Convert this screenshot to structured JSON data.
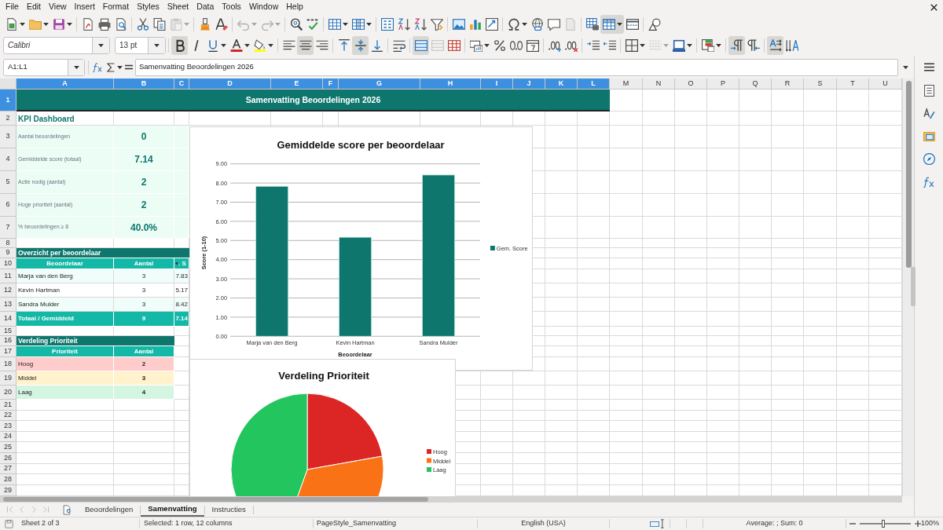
{
  "menu_bar": {
    "items": [
      "File",
      "Edit",
      "View",
      "Insert",
      "Format",
      "Styles",
      "Sheet",
      "Data",
      "Tools",
      "Window",
      "Help"
    ]
  },
  "standard_toolbar": {
    "groups": [
      {
        "buttons": [
          {
            "kind": "new",
            "dropdown": true,
            "pressed": false,
            "disabled": false
          },
          {
            "kind": "open",
            "dropdown": true,
            "pressed": false,
            "disabled": false
          },
          {
            "kind": "save",
            "dropdown": true,
            "pressed": false,
            "disabled": false
          }
        ]
      },
      {
        "buttons": [
          {
            "kind": "pdf",
            "dropdown": false,
            "pressed": false,
            "disabled": false
          },
          {
            "kind": "print",
            "dropdown": false,
            "pressed": false,
            "disabled": false
          },
          {
            "kind": "preview",
            "dropdown": false,
            "pressed": false,
            "disabled": false
          }
        ]
      },
      {
        "buttons": [
          {
            "kind": "cut",
            "dropdown": false,
            "pressed": false,
            "disabled": false
          },
          {
            "kind": "copy",
            "dropdown": false,
            "pressed": false,
            "disabled": false
          },
          {
            "kind": "paste",
            "dropdown": true,
            "pressed": false,
            "disabled": true
          }
        ]
      },
      {
        "buttons": [
          {
            "kind": "clone",
            "dropdown": false,
            "pressed": false,
            "disabled": false
          },
          {
            "kind": "clear",
            "dropdown": false,
            "pressed": false,
            "disabled": false
          }
        ]
      },
      {
        "buttons": [
          {
            "kind": "undo",
            "dropdown": true,
            "pressed": false,
            "disabled": true
          },
          {
            "kind": "redo",
            "dropdown": true,
            "pressed": false,
            "disabled": true
          }
        ]
      },
      {
        "buttons": [
          {
            "kind": "find",
            "dropdown": false,
            "pressed": false,
            "disabled": false
          },
          {
            "kind": "spelling",
            "dropdown": false,
            "pressed": false,
            "disabled": false
          }
        ]
      },
      {
        "buttons": [
          {
            "kind": "rows",
            "dropdown": true,
            "pressed": false,
            "disabled": false
          },
          {
            "kind": "columns",
            "dropdown": true,
            "pressed": false,
            "disabled": false
          }
        ]
      },
      {
        "buttons": [
          {
            "kind": "sort",
            "dropdown": false,
            "pressed": false,
            "disabled": false
          },
          {
            "kind": "ascending",
            "dropdown": false,
            "pressed": false,
            "disabled": false
          },
          {
            "kind": "descending",
            "dropdown": false,
            "pressed": false,
            "disabled": false
          },
          {
            "kind": "filter",
            "dropdown": false,
            "pressed": false,
            "disabled": false
          }
        ]
      },
      {
        "buttons": [
          {
            "kind": "image",
            "dropdown": false,
            "pressed": false,
            "disabled": false
          },
          {
            "kind": "chart",
            "dropdown": false,
            "pressed": false,
            "disabled": false
          },
          {
            "kind": "pivot",
            "dropdown": false,
            "pressed": false,
            "disabled": false
          }
        ]
      },
      {
        "buttons": [
          {
            "kind": "symbol",
            "dropdown": true,
            "pressed": false,
            "disabled": false
          },
          {
            "kind": "hyperlink",
            "dropdown": false,
            "pressed": false,
            "disabled": false
          },
          {
            "kind": "comment",
            "dropdown": false,
            "pressed": false,
            "disabled": false
          },
          {
            "kind": "headers",
            "dropdown": false,
            "pressed": false,
            "disabled": true
          }
        ]
      },
      {
        "buttons": [
          {
            "kind": "printarea",
            "dropdown": false,
            "pressed": false,
            "disabled": false
          },
          {
            "kind": "freeze",
            "dropdown": true,
            "pressed": true,
            "disabled": false
          },
          {
            "kind": "split",
            "dropdown": false,
            "pressed": false,
            "disabled": false
          }
        ]
      },
      {
        "buttons": [
          {
            "kind": "shapes",
            "dropdown": false,
            "pressed": false,
            "disabled": false
          }
        ]
      }
    ]
  },
  "formatting_toolbar": {
    "font_name": "Calibri",
    "font_size": "13 pt",
    "groups": [
      {
        "buttons": [
          {
            "kind": "bold",
            "dropdown": false,
            "pressed": true,
            "disabled": false
          },
          {
            "kind": "italic",
            "dropdown": false,
            "pressed": false,
            "disabled": false
          },
          {
            "kind": "underline",
            "dropdown": true,
            "pressed": false,
            "disabled": false
          },
          {
            "kind": "fontcolor",
            "dropdown": true,
            "pressed": false,
            "disabled": false
          },
          {
            "kind": "highlight",
            "dropdown": true,
            "pressed": false,
            "disabled": false
          }
        ]
      },
      {
        "buttons": [
          {
            "kind": "alignleft",
            "dropdown": false,
            "pressed": false,
            "disabled": false
          },
          {
            "kind": "aligncenter",
            "dropdown": false,
            "pressed": true,
            "disabled": false
          },
          {
            "kind": "alignright",
            "dropdown": false,
            "pressed": false,
            "disabled": false
          }
        ]
      },
      {
        "buttons": [
          {
            "kind": "aligntop",
            "dropdown": false,
            "pressed": false,
            "disabled": false
          },
          {
            "kind": "alignmiddle",
            "dropdown": false,
            "pressed": true,
            "disabled": false
          },
          {
            "kind": "alignbottom",
            "dropdown": false,
            "pressed": false,
            "disabled": false
          }
        ]
      },
      {
        "buttons": [
          {
            "kind": "wrap",
            "dropdown": false,
            "pressed": false,
            "disabled": false
          }
        ]
      },
      {
        "buttons": [
          {
            "kind": "mergecenter",
            "dropdown": false,
            "pressed": true,
            "disabled": false
          },
          {
            "kind": "merge",
            "dropdown": false,
            "pressed": false,
            "disabled": true
          },
          {
            "kind": "unmerge",
            "dropdown": false,
            "pressed": false,
            "disabled": false
          }
        ]
      },
      {
        "buttons": [
          {
            "kind": "currency",
            "dropdown": true,
            "pressed": false,
            "disabled": false
          },
          {
            "kind": "percent",
            "dropdown": false,
            "pressed": false,
            "disabled": false
          },
          {
            "kind": "number",
            "dropdown": false,
            "pressed": false,
            "disabled": false
          },
          {
            "kind": "date",
            "dropdown": false,
            "pressed": false,
            "disabled": false
          }
        ]
      },
      {
        "buttons": [
          {
            "kind": "adddecimal",
            "dropdown": false,
            "pressed": false,
            "disabled": false
          },
          {
            "kind": "deletedecimal",
            "dropdown": false,
            "pressed": false,
            "disabled": false
          }
        ]
      },
      {
        "buttons": [
          {
            "kind": "indent",
            "dropdown": false,
            "pressed": false,
            "disabled": false
          },
          {
            "kind": "outdent",
            "dropdown": false,
            "pressed": false,
            "disabled": false
          }
        ]
      },
      {
        "buttons": [
          {
            "kind": "borders",
            "dropdown": true,
            "pressed": false,
            "disabled": false
          },
          {
            "kind": "borderstyle",
            "dropdown": true,
            "pressed": false,
            "disabled": true
          },
          {
            "kind": "bordercolor",
            "dropdown": true,
            "pressed": false,
            "disabled": false
          }
        ]
      },
      {
        "buttons": [
          {
            "kind": "conditional",
            "dropdown": true,
            "pressed": false,
            "disabled": false
          }
        ]
      },
      {
        "buttons": [
          {
            "kind": "ltr",
            "dropdown": false,
            "pressed": true,
            "disabled": false
          },
          {
            "kind": "rtl",
            "dropdown": false,
            "pressed": false,
            "disabled": false
          }
        ]
      },
      {
        "buttons": [
          {
            "kind": "textdirection",
            "dropdown": false,
            "pressed": true,
            "disabled": false
          },
          {
            "kind": "verticaltext",
            "dropdown": false,
            "pressed": false,
            "disabled": false
          }
        ]
      }
    ]
  },
  "formula_bar": {
    "name_box": "A1:L1",
    "formula": "Samenvatting Beoordelingen 2026"
  },
  "sidebar": {
    "buttons": [
      {
        "kind": "menu"
      },
      {
        "kind": "properties"
      },
      {
        "kind": "styles"
      },
      {
        "kind": "gallery"
      },
      {
        "kind": "navigator"
      },
      {
        "kind": "functions"
      }
    ]
  },
  "sheet": {
    "columns": [
      {
        "label": "A",
        "selected": true
      },
      {
        "label": "B",
        "selected": true
      },
      {
        "label": "C",
        "selected": true
      },
      {
        "label": "D",
        "selected": true
      },
      {
        "label": "E",
        "selected": true
      },
      {
        "label": "F",
        "selected": true
      },
      {
        "label": "G",
        "selected": true
      },
      {
        "label": "H",
        "selected": true
      },
      {
        "label": "I",
        "selected": true
      },
      {
        "label": "J",
        "selected": true
      },
      {
        "label": "K",
        "selected": true
      },
      {
        "label": "L",
        "selected": true
      },
      {
        "label": "M",
        "selected": false
      },
      {
        "label": "N",
        "selected": false
      },
      {
        "label": "O",
        "selected": false
      },
      {
        "label": "P",
        "selected": false
      },
      {
        "label": "Q",
        "selected": false
      },
      {
        "label": "R",
        "selected": false
      },
      {
        "label": "S",
        "selected": false
      },
      {
        "label": "T",
        "selected": false
      },
      {
        "label": "U",
        "selected": false
      }
    ],
    "rows": [
      {
        "label": "1",
        "selected": true
      },
      {
        "label": "2",
        "selected": false
      },
      {
        "label": "3",
        "selected": false
      },
      {
        "label": "4",
        "selected": false
      },
      {
        "label": "5",
        "selected": false
      },
      {
        "label": "6",
        "selected": false
      },
      {
        "label": "7",
        "selected": false
      },
      {
        "label": "8",
        "selected": false
      },
      {
        "label": "9",
        "selected": false
      },
      {
        "label": "10",
        "selected": false
      },
      {
        "label": "11",
        "selected": false
      },
      {
        "label": "12",
        "selected": false
      },
      {
        "label": "13",
        "selected": false
      },
      {
        "label": "14",
        "selected": false
      },
      {
        "label": "15",
        "selected": false
      },
      {
        "label": "16",
        "selected": false
      },
      {
        "label": "17",
        "selected": false
      },
      {
        "label": "18",
        "selected": false
      },
      {
        "label": "19",
        "selected": false
      },
      {
        "label": "20",
        "selected": false
      },
      {
        "label": "21",
        "selected": false
      },
      {
        "label": "22",
        "selected": false
      },
      {
        "label": "23",
        "selected": false
      },
      {
        "label": "24",
        "selected": false
      },
      {
        "label": "25",
        "selected": false
      },
      {
        "label": "26",
        "selected": false
      },
      {
        "label": "27",
        "selected": false
      },
      {
        "label": "28",
        "selected": false
      },
      {
        "label": "29",
        "selected": false
      }
    ],
    "title": {
      "text": "Samenvatting Beoordelingen 2026",
      "selected": true
    },
    "kpi": {
      "heading": "KPI Dashboard",
      "items": [
        {
          "label": "Aantal beoordelingen",
          "value": "0"
        },
        {
          "label": "Gemiddelde score (totaal)",
          "value": "7.14"
        },
        {
          "label": "Actie nodig (aantal)",
          "value": "2"
        },
        {
          "label": "Hoge prioriteit (aantal)",
          "value": "2"
        },
        {
          "label": "% beoordelingen ≥ 8",
          "value": "40.0%"
        }
      ]
    },
    "reviewer_table": {
      "heading": "Overzicht per beoordelaar",
      "columns": [
        "Beoordelaar",
        "Aantal",
        ". S"
      ],
      "rows": [
        [
          "Marja van den Berg",
          "3",
          "7.83"
        ],
        [
          "Kevin Hartman",
          "3",
          "5.17"
        ],
        [
          "Sandra Mulder",
          "3",
          "8.42"
        ]
      ],
      "total": [
        "Totaal / Gemiddeld",
        "9",
        "7.14"
      ]
    },
    "priority_table": {
      "heading": "Verdeling Prioriteit",
      "columns": [
        "Prioriteit",
        "Aantal"
      ],
      "rows": [
        {
          "label": "Hoog",
          "count": "2",
          "color": "#ffcccc"
        },
        {
          "label": "Middel",
          "count": "3",
          "color": "#fff2cc"
        },
        {
          "label": "Laag",
          "count": "4",
          "color": "#d5f5e3"
        }
      ]
    },
    "charts": [
      {
        "chart_data": {
          "type": "bar",
          "title": "Gemiddelde score per beoordelaar",
          "xlabel": "Beoordelaar",
          "ylabel": "Score (1-10)",
          "categories": [
            "Marja van den Berg",
            "Kevin Hartman",
            "Sandra Mulder"
          ],
          "series": [
            {
              "name": "Gem. Score",
              "color": "#0f766e",
              "values": [
                7.83,
                5.17,
                8.42
              ]
            }
          ],
          "ylim": [
            0,
            9
          ],
          "yticks": [
            {
              "value": 0,
              "label": "0.00"
            },
            {
              "value": 1,
              "label": "1.00"
            },
            {
              "value": 2,
              "label": "2.00"
            },
            {
              "value": 3,
              "label": "3.00"
            },
            {
              "value": 4,
              "label": "4.00"
            },
            {
              "value": 5,
              "label": "5.00"
            },
            {
              "value": 6,
              "label": "6.00"
            },
            {
              "value": 7,
              "label": "7.00"
            },
            {
              "value": 8,
              "label": "8.00"
            },
            {
              "value": 9,
              "label": "9.00"
            }
          ],
          "grid": true,
          "legend": "right"
        }
      },
      {
        "chart_data": {
          "type": "pie",
          "title": "Verdeling Prioriteit",
          "categories": [
            "Hoog",
            "Middel",
            "Laag"
          ],
          "values": [
            22.2,
            33.3,
            44.5
          ],
          "colors": [
            "#dc2626",
            "#f97316",
            "#22c55e"
          ],
          "legend": "right"
        }
      }
    ]
  },
  "sheet_nav": [
    {
      "kind": "first",
      "disabled": true
    },
    {
      "kind": "previous",
      "disabled": true
    },
    {
      "kind": "next",
      "disabled": true
    },
    {
      "kind": "last",
      "disabled": true
    }
  ],
  "sheet_tabs": [
    {
      "label": "Beoordelingen",
      "selected": false
    },
    {
      "label": "Samenvatting",
      "selected": true
    },
    {
      "label": "Instructies",
      "selected": false
    }
  ],
  "status_bar": {
    "sheet": "Sheet 2 of 3",
    "selection": "Selected: 1 row, 12 columns",
    "page_style": "PageStyle_Samenvatting",
    "language": "English (USA)",
    "summary": "Average: ; Sum: 0",
    "zoom": {
      "level": 0.46,
      "text": "100%"
    }
  }
}
